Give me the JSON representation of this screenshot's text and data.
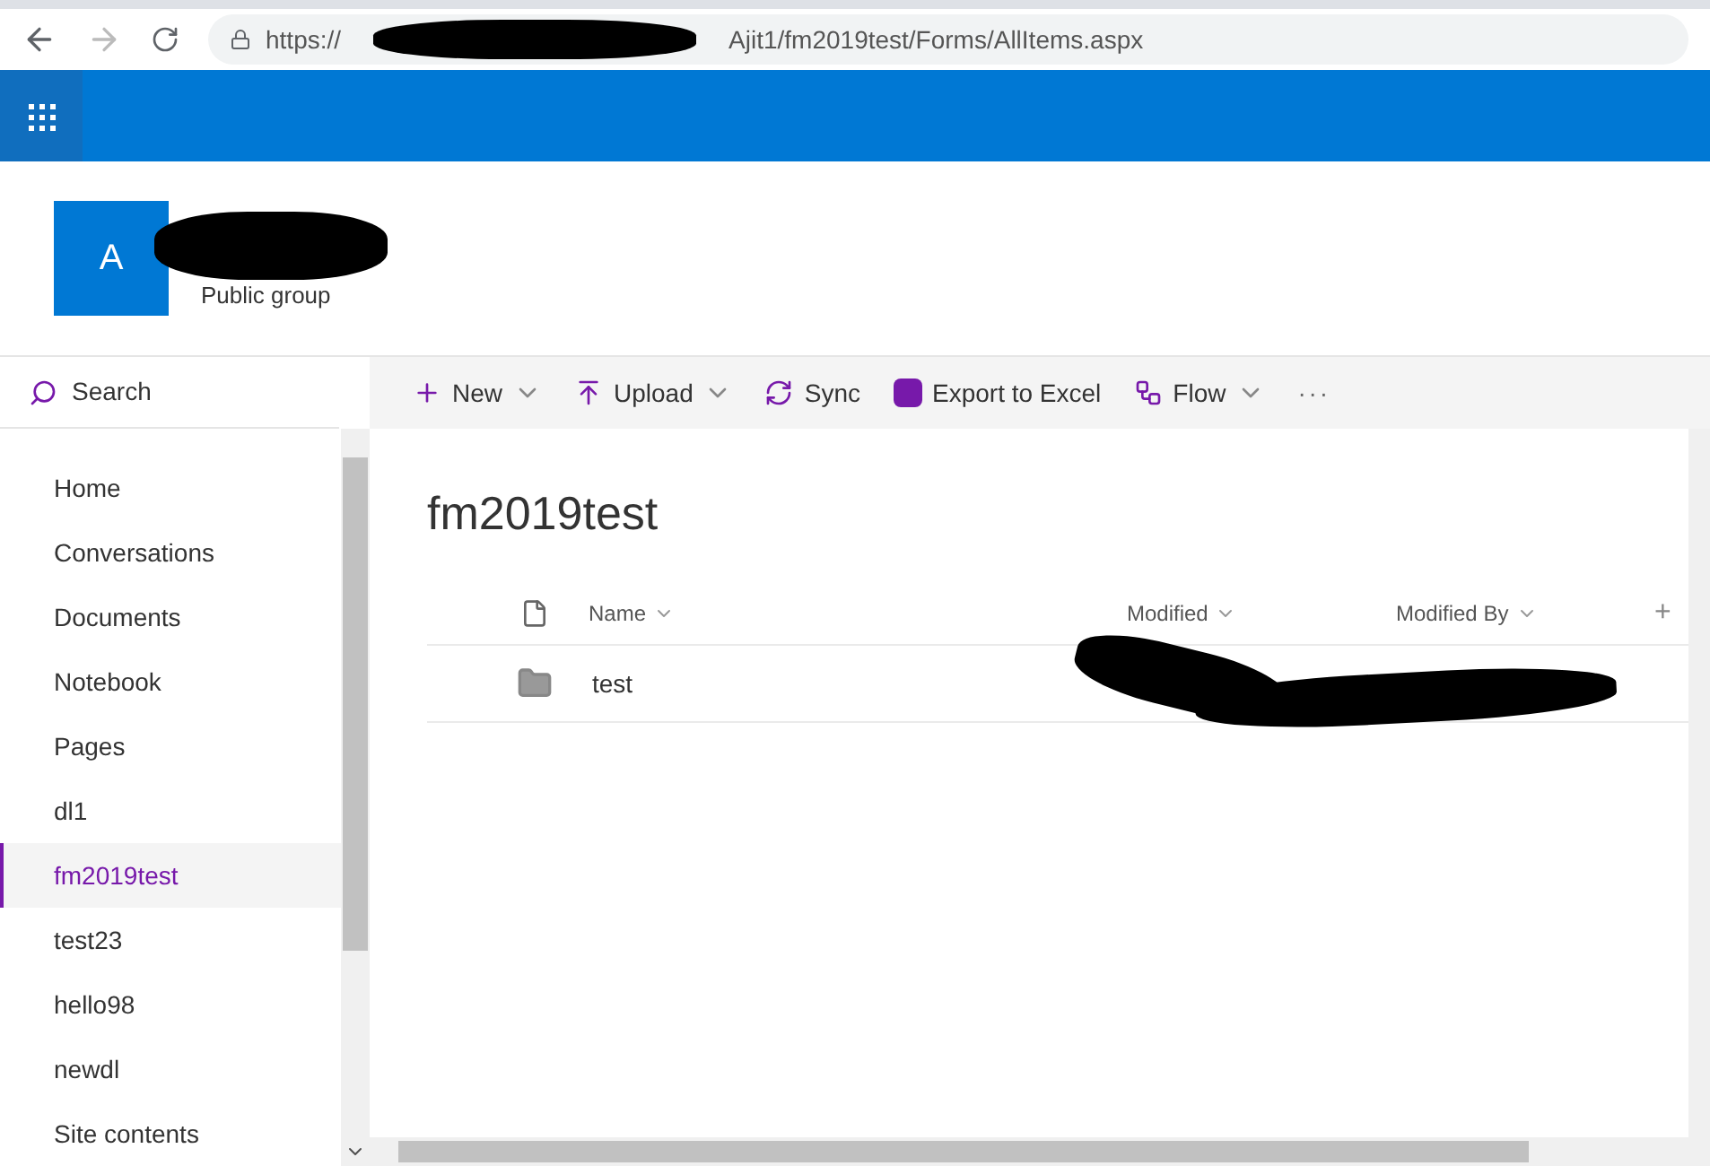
{
  "browser": {
    "url_start": "https://",
    "url_end": "Ajit1/fm2019test/Forms/AllItems.aspx"
  },
  "site": {
    "avatar_letter": "A",
    "subtitle": "Public group"
  },
  "search": {
    "placeholder": "Search"
  },
  "nav": [
    {
      "label": "Home",
      "selected": false
    },
    {
      "label": "Conversations",
      "selected": false
    },
    {
      "label": "Documents",
      "selected": false
    },
    {
      "label": "Notebook",
      "selected": false
    },
    {
      "label": "Pages",
      "selected": false
    },
    {
      "label": "dl1",
      "selected": false
    },
    {
      "label": "fm2019test",
      "selected": true
    },
    {
      "label": "test23",
      "selected": false
    },
    {
      "label": "hello98",
      "selected": false
    },
    {
      "label": "newdl",
      "selected": false
    },
    {
      "label": "Site contents",
      "selected": false
    }
  ],
  "commands": [
    {
      "kind": "new",
      "label": "New",
      "dropdown": true
    },
    {
      "kind": "upload",
      "label": "Upload",
      "dropdown": true
    },
    {
      "kind": "sync",
      "label": "Sync",
      "dropdown": false
    },
    {
      "kind": "excel",
      "label": "Export to Excel",
      "dropdown": false
    },
    {
      "kind": "flow",
      "label": "Flow",
      "dropdown": true
    },
    {
      "kind": "more",
      "label": "···",
      "dropdown": false
    }
  ],
  "library": {
    "title": "fm2019test",
    "columns": [
      {
        "label": "Name"
      },
      {
        "label": "Modified"
      },
      {
        "label": "Modified By"
      }
    ],
    "add_column": "+",
    "rows": [
      {
        "kind": "folder",
        "name": "test"
      }
    ]
  }
}
